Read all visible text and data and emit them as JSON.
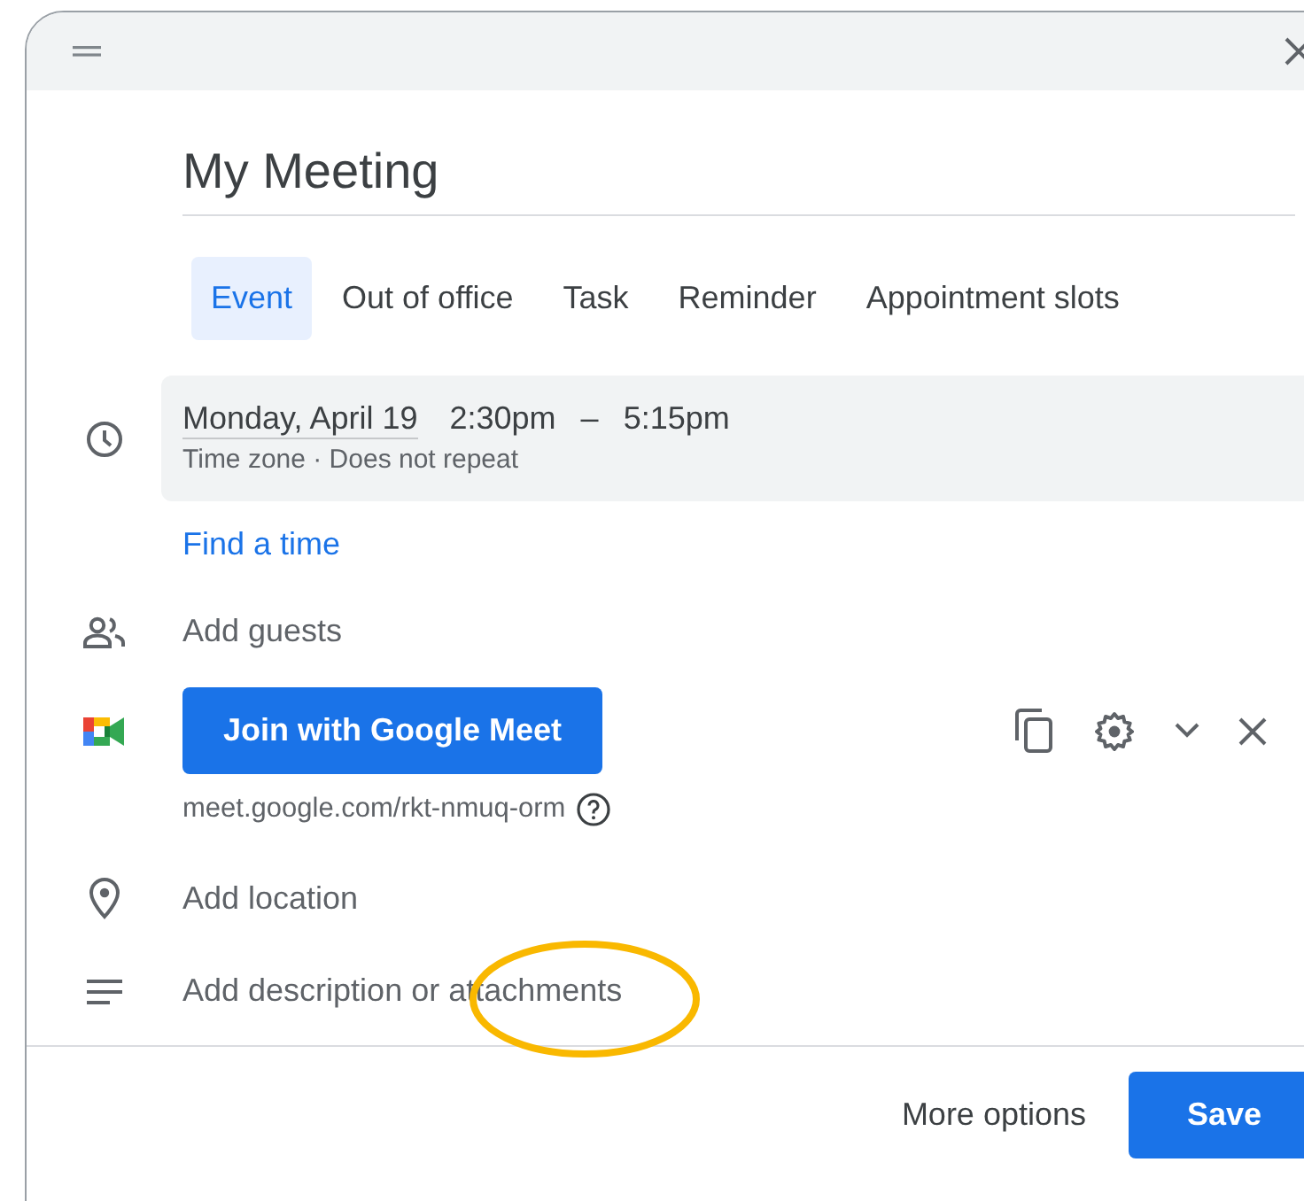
{
  "dialog": {
    "title_field": {
      "value": "My Meeting"
    },
    "tabs": [
      {
        "label": "Event",
        "selected": true
      },
      {
        "label": "Out of office",
        "selected": false
      },
      {
        "label": "Task",
        "selected": false
      },
      {
        "label": "Reminder",
        "selected": false
      },
      {
        "label": "Appointment slots",
        "selected": false
      }
    ],
    "time": {
      "date": "Monday, April 19",
      "start": "2:30pm",
      "dash": "–",
      "end": "5:15pm",
      "details": "Time zone · Does not repeat"
    },
    "find_a_time": "Find a time",
    "guests": {
      "placeholder": "Add guests"
    },
    "meet": {
      "button": "Join with Google Meet",
      "link": "meet.google.com/rkt-nmuq-orm"
    },
    "location": {
      "placeholder": "Add location"
    },
    "description": {
      "placeholder": "Add description or attachments"
    },
    "annotation": {
      "kind": "ellipse",
      "color": "#f9b800"
    },
    "footer": {
      "more_options": "More options",
      "save": "Save"
    }
  }
}
